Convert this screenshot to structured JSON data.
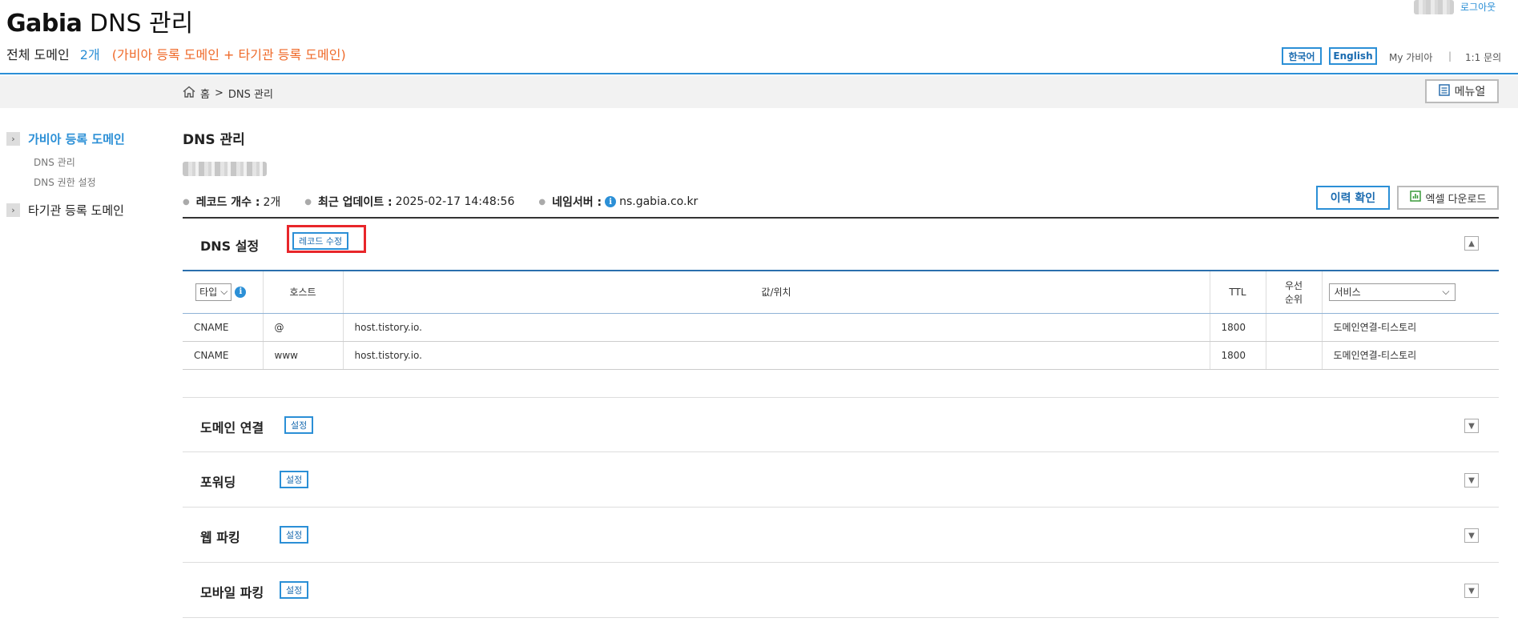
{
  "header": {
    "logo_brand": "Gabia",
    "logo_title": "DNS 관리",
    "summary_label": "전체 도메인",
    "summary_count": "2개",
    "summary_desc": "(가비아 등록 도메인 + 타기관 등록 도메인)",
    "logout": "로그아웃",
    "lang_ko": "한국어",
    "lang_en": "English",
    "my_gabia": "My 가비아",
    "separator": "|",
    "inquiry": "1:1 문의"
  },
  "breadcrumb": {
    "home": "홈",
    "sep": ">",
    "current": "DNS 관리",
    "manual": "메뉴얼"
  },
  "sidebar": {
    "group1": "가비아 등록 도메인",
    "group1_items": [
      "DNS 관리",
      "DNS 권한 설정"
    ],
    "group2": "타기관 등록 도메인"
  },
  "main": {
    "title": "DNS 관리",
    "stats": {
      "record_label": "레코드 개수 :",
      "record_value": "2개",
      "update_label": "최근 업데이트 :",
      "update_value": "2025-02-17 14:48:56",
      "ns_label": "네임서버 :",
      "ns_value": "ns.gabia.co.kr"
    },
    "history_btn": "이력 확인",
    "excel_btn": "엑셀 다운로드"
  },
  "dns_settings": {
    "title": "DNS 설정",
    "edit_btn": "레코드 수정",
    "columns": {
      "type": "타입",
      "host": "호스트",
      "value": "값/위치",
      "ttl": "TTL",
      "priority_line1": "우선",
      "priority_line2": "순위",
      "service": "서비스"
    },
    "rows": [
      {
        "type": "CNAME",
        "host": "@",
        "value": "host.tistory.io.",
        "ttl": "1800",
        "priority": "",
        "service": "도메인연결-티스토리"
      },
      {
        "type": "CNAME",
        "host": "www",
        "value": "host.tistory.io.",
        "ttl": "1800",
        "priority": "",
        "service": "도메인연결-티스토리"
      }
    ]
  },
  "sections": [
    {
      "title": "도메인 연결",
      "button": "설정"
    },
    {
      "title": "포워딩",
      "button": "설정"
    },
    {
      "title": "웹 파킹",
      "button": "설정"
    },
    {
      "title": "모바일 파킹",
      "button": "설정"
    }
  ],
  "colors": {
    "accent": "#2b8fd6",
    "orange": "#ef6a2a",
    "highlight": "#e8262a"
  }
}
